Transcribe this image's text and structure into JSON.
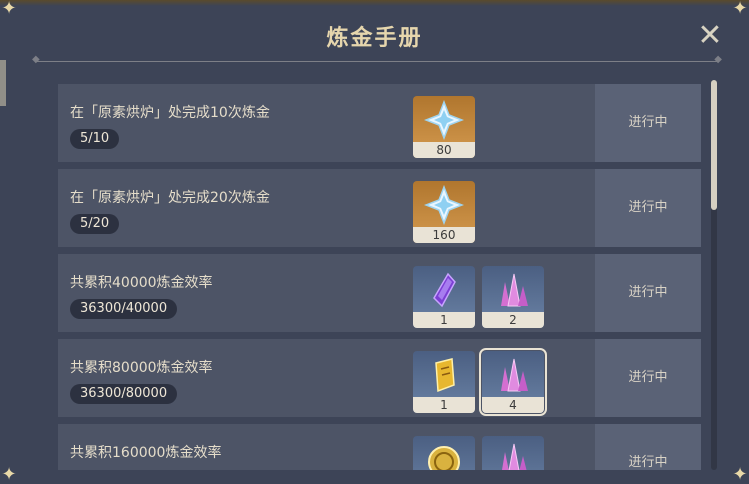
{
  "title": "炼金手册",
  "close_icon": "close-icon",
  "status_label": "进行中",
  "rows": [
    {
      "desc": "在「原素烘炉」处完成10次炼金",
      "prog": "5/10",
      "rewards": [
        {
          "qty": "80",
          "icon": "primogem-icon",
          "bg": "orange"
        }
      ]
    },
    {
      "desc": "在「原素烘炉」处完成20次炼金",
      "prog": "5/20",
      "rewards": [
        {
          "qty": "160",
          "icon": "primogem-icon",
          "bg": "orange"
        }
      ]
    },
    {
      "desc": "共累积40000炼金效率",
      "prog": "36300/40000",
      "rewards": [
        {
          "qty": "1",
          "icon": "purple-gem-icon",
          "bg": "blue"
        },
        {
          "qty": "2",
          "icon": "crystal-cluster-icon",
          "bg": "blue"
        }
      ]
    },
    {
      "desc": "共累积80000炼金效率",
      "prog": "36300/80000",
      "rewards": [
        {
          "qty": "1",
          "icon": "gold-book-icon",
          "bg": "blue"
        },
        {
          "qty": "4",
          "icon": "crystal-cluster-icon",
          "bg": "blue",
          "selected": true
        }
      ]
    },
    {
      "desc": "共累积160000炼金效率",
      "prog": "",
      "rewards": [
        {
          "qty": "",
          "icon": "coin-icon",
          "bg": "blue"
        },
        {
          "qty": "",
          "icon": "crystal-cluster-icon",
          "bg": "blue"
        }
      ]
    }
  ]
}
